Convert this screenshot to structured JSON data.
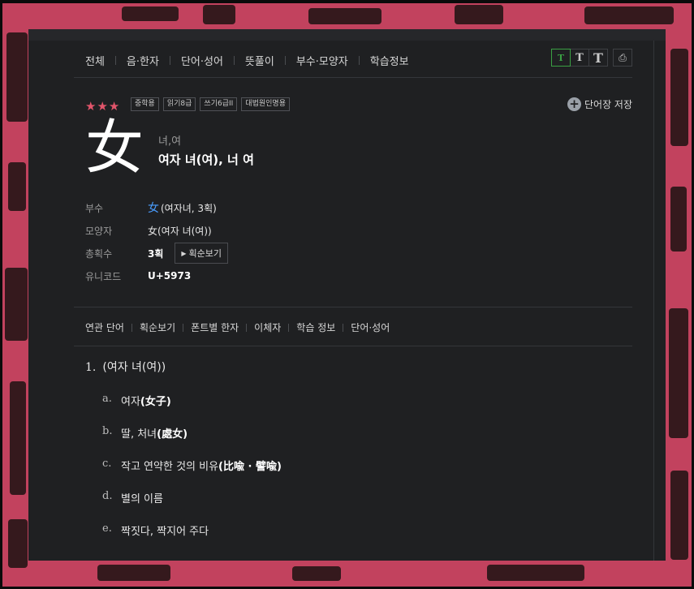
{
  "nav": {
    "items": [
      "전체",
      "음·한자",
      "단어·성어",
      "뜻풀이",
      "부수·모양자",
      "학습정보"
    ]
  },
  "tools": {
    "font_small": "T",
    "font_medium": "T",
    "font_large": "T",
    "print": "⎙"
  },
  "entry": {
    "stars": "★★★",
    "badges": [
      "중학용",
      "읽기8급",
      "쓰기6급II",
      "대법원인명용"
    ],
    "save_label": "단어장 저장",
    "character": "女",
    "reading": "녀,여",
    "meaning": "여자 녀(여), 너 여"
  },
  "info": {
    "radical_label": "부수",
    "radical_char": "女",
    "radical_desc": "(여자녀, 3획)",
    "shape_label": "모양자",
    "shape_value": "女(여자 녀(여))",
    "strokes_label": "총획수",
    "strokes_value": "3획",
    "stroke_order_button": "획순보기",
    "unicode_label": "유니코드",
    "unicode_value": "U+5973"
  },
  "subnav": {
    "items": [
      "연관 단어",
      "획순보기",
      "폰트별 한자",
      "이체자",
      "학습 정보",
      "단어·성어"
    ]
  },
  "definition": {
    "number": "1.",
    "head": "(여자 녀(여))",
    "subs": [
      {
        "letter": "a.",
        "text": "여자",
        "hanja": "(女子)"
      },
      {
        "letter": "b.",
        "text": "딸, 처녀",
        "hanja": "(處女)"
      },
      {
        "letter": "c.",
        "text": "작고 연약한 것의 비유",
        "hanja": "(比喩 · 譬喩)"
      },
      {
        "letter": "d.",
        "text": "별의 이름",
        "hanja": ""
      },
      {
        "letter": "e.",
        "text": "짝짓다, 짝지어 주다",
        "hanja": ""
      }
    ]
  },
  "colors": {
    "panel_bg": "#1f2022",
    "accent_green": "#3aa043",
    "star_red": "#e2556b",
    "radical_blue": "#4a9eff",
    "backdrop_pink": "#c2425e"
  }
}
